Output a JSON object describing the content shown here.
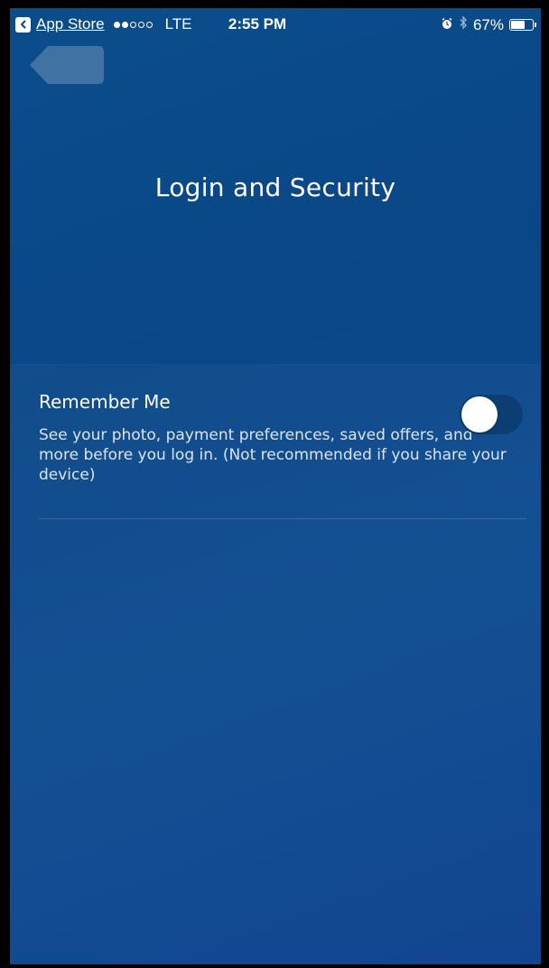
{
  "status_bar": {
    "back_app_label": "App Store",
    "carrier": "LTE",
    "signal_bars_filled": 2,
    "signal_bars_total": 5,
    "time": "2:55 PM",
    "battery_percent": "67%",
    "battery_level": 0.67,
    "icons": [
      "back-arrow-icon",
      "alarm-icon",
      "bluetooth-icon",
      "battery-icon"
    ]
  },
  "header": {
    "title": "Login and Security"
  },
  "settings": {
    "remember_me": {
      "title": "Remember Me",
      "description": "See your photo, payment preferences, saved offers, and more before you log in. (Not recommended if you share your device)",
      "enabled": false
    }
  },
  "colors": {
    "background": "#0a4787",
    "toggle_track": "#0d3e73",
    "text": "#ffffff"
  }
}
